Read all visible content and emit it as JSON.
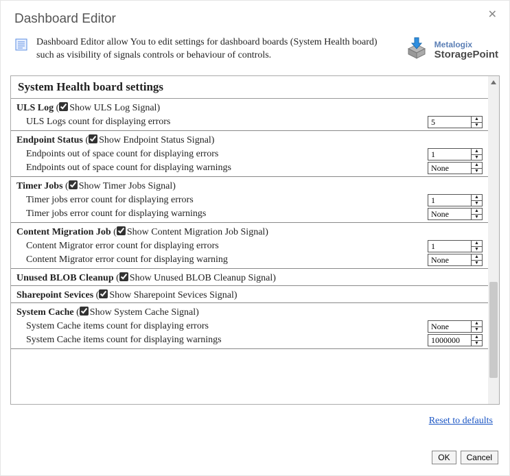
{
  "window": {
    "title": "Dashboard Editor",
    "intro": "Dashboard Editor allow You to edit settings for dashboard boards (System Health board) such as visibility of signals controls or behaviour of controls."
  },
  "logo": {
    "line1": "Metalogix",
    "line2": "StoragePoint"
  },
  "panel": {
    "heading": "System Health board settings"
  },
  "sections": [
    {
      "title": "ULS Log",
      "checkbox_label": "Show ULS Log Signal",
      "checked": true,
      "rows": [
        {
          "label": "ULS Logs count for displaying errors",
          "value": "5"
        }
      ]
    },
    {
      "title": "Endpoint Status",
      "checkbox_label": "Show Endpoint Status Signal",
      "checked": true,
      "rows": [
        {
          "label": "Endpoints out of space count for displaying errors",
          "value": "1"
        },
        {
          "label": "Endpoints out of space count for displaying warnings",
          "value": "None"
        }
      ]
    },
    {
      "title": "Timer Jobs",
      "checkbox_label": "Show Timer Jobs Signal",
      "checked": true,
      "rows": [
        {
          "label": "Timer jobs error count for displaying errors",
          "value": "1"
        },
        {
          "label": "Timer jobs error count for displaying warnings",
          "value": "None"
        }
      ]
    },
    {
      "title": "Content Migration Job",
      "checkbox_label": "Show Content Migration Job Signal",
      "checked": true,
      "rows": [
        {
          "label": "Content Migrator error count for displaying errors",
          "value": "1"
        },
        {
          "label": "Content Migrator error count for displaying warning",
          "value": "None"
        }
      ]
    },
    {
      "title": "Unused BLOB Cleanup",
      "checkbox_label": "Show Unused BLOB Cleanup Signal",
      "checked": true,
      "rows": []
    },
    {
      "title": "Sharepoint Sevices",
      "checkbox_label": "Show Sharepoint Sevices Signal",
      "checked": true,
      "rows": []
    },
    {
      "title": "System Cache",
      "checkbox_label": "Show System Cache Signal",
      "checked": true,
      "rows": [
        {
          "label": "System Cache items count for displaying errors",
          "value": "None"
        },
        {
          "label": "System Cache items count for displaying warnings",
          "value": "1000000"
        }
      ]
    }
  ],
  "reset_link": "Reset to defaults",
  "buttons": {
    "ok": "OK",
    "cancel": "Cancel"
  }
}
